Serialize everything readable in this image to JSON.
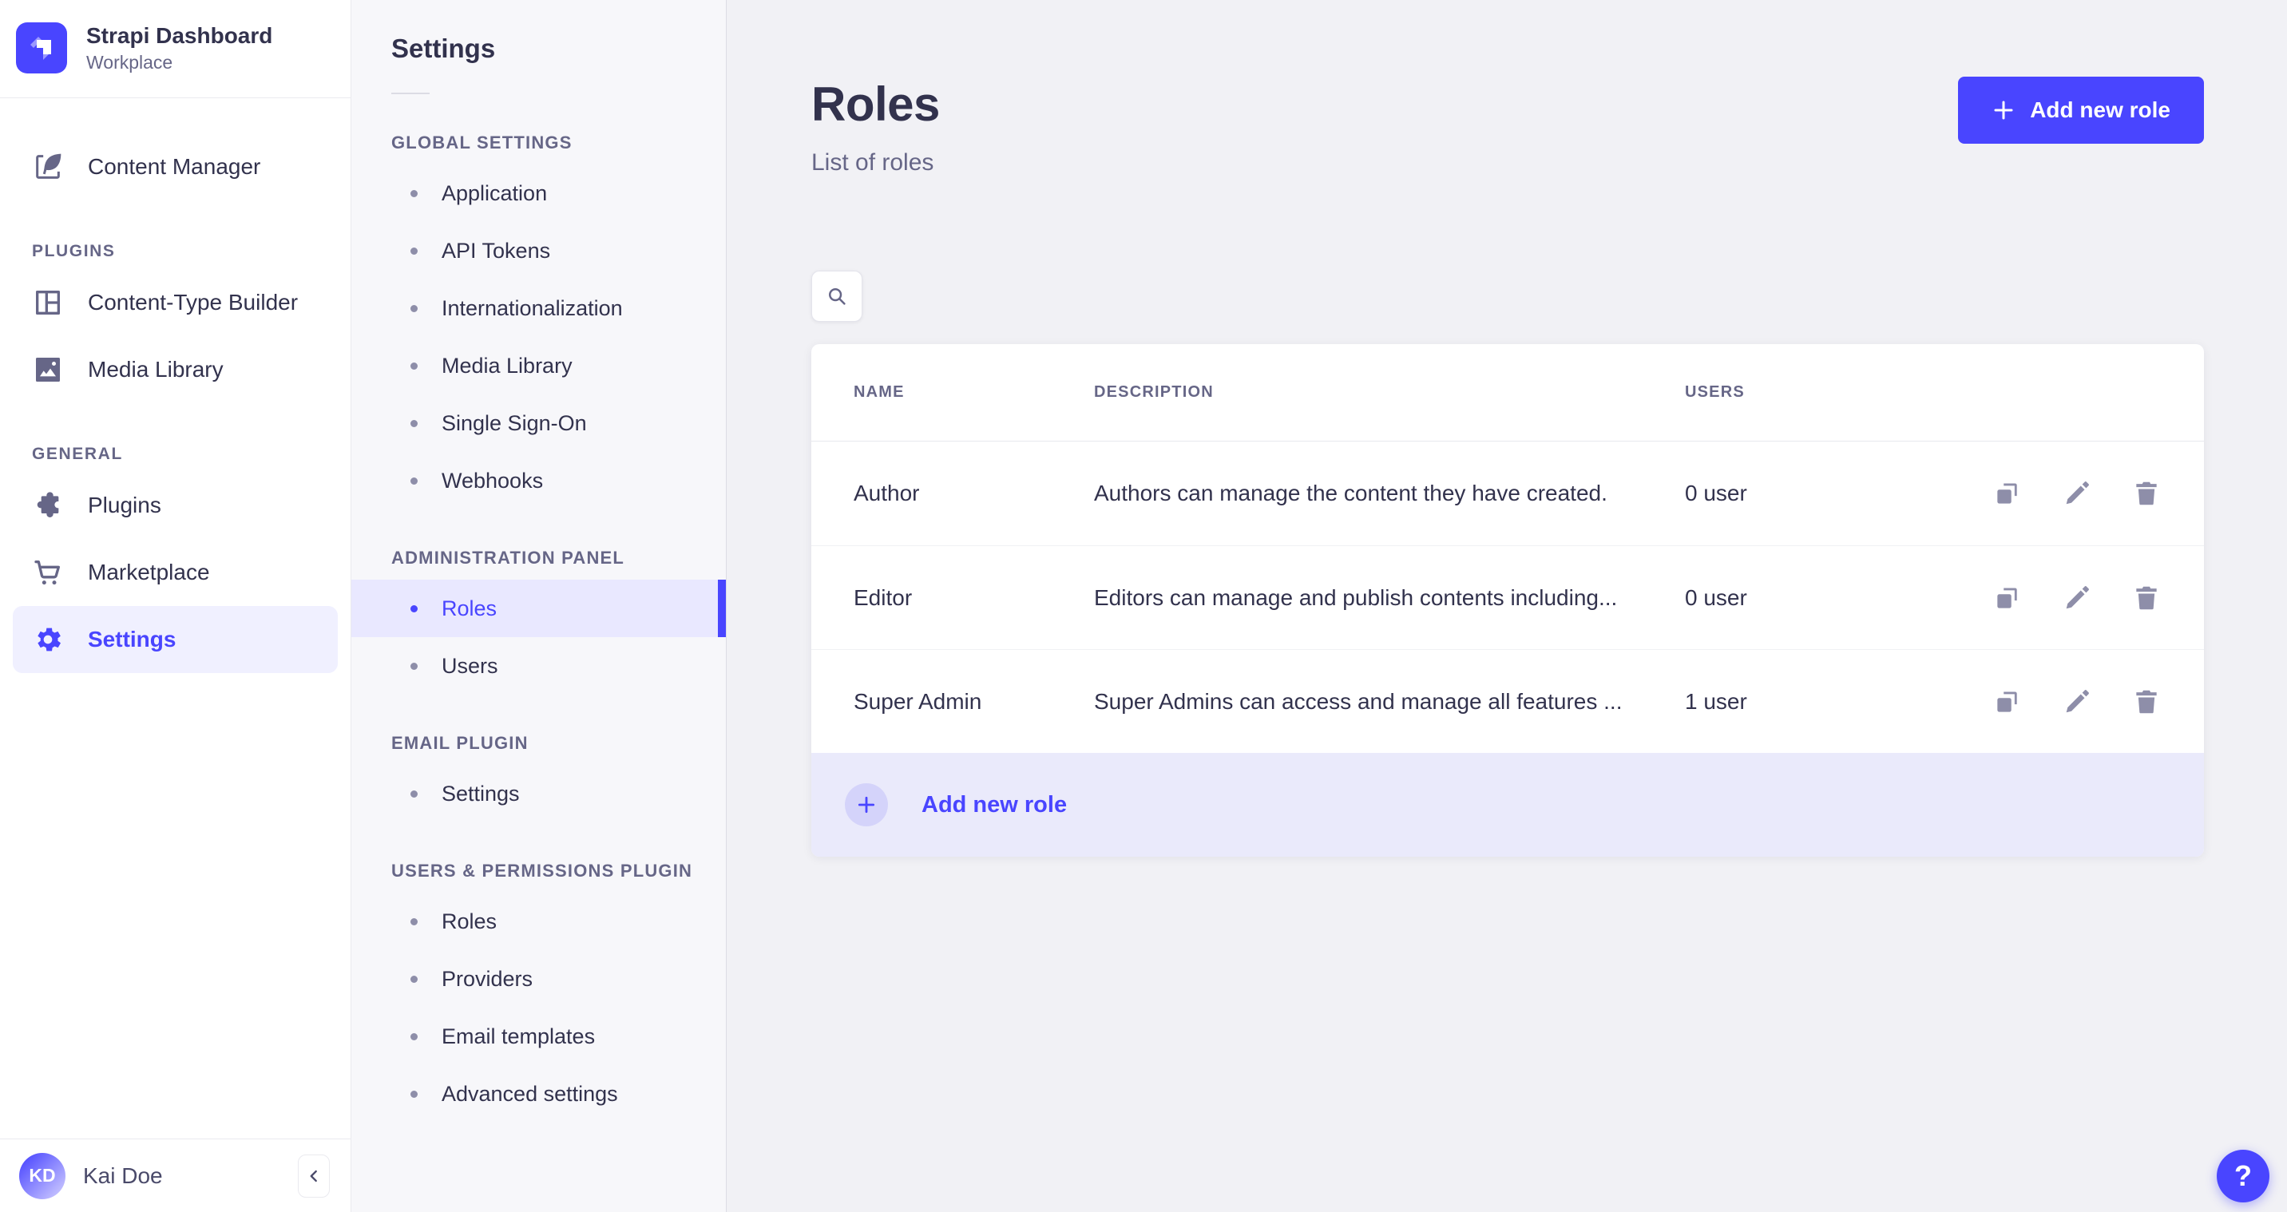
{
  "brand": {
    "title": "Strapi Dashboard",
    "subtitle": "Workplace"
  },
  "sidebar": {
    "content_manager": "Content Manager",
    "sections": [
      {
        "title": "PLUGINS",
        "items": [
          {
            "label": "Content-Type Builder"
          },
          {
            "label": "Media Library"
          }
        ]
      },
      {
        "title": "GENERAL",
        "items": [
          {
            "label": "Plugins"
          },
          {
            "label": "Marketplace"
          },
          {
            "label": "Settings"
          }
        ]
      }
    ],
    "user": {
      "initials": "KD",
      "name": "Kai Doe"
    }
  },
  "subnav": {
    "title": "Settings",
    "sections": [
      {
        "title": "GLOBAL SETTINGS",
        "items": [
          {
            "label": "Application"
          },
          {
            "label": "API Tokens"
          },
          {
            "label": "Internationalization"
          },
          {
            "label": "Media Library"
          },
          {
            "label": "Single Sign-On"
          },
          {
            "label": "Webhooks"
          }
        ]
      },
      {
        "title": "ADMINISTRATION PANEL",
        "items": [
          {
            "label": "Roles"
          },
          {
            "label": "Users"
          }
        ]
      },
      {
        "title": "EMAIL PLUGIN",
        "items": [
          {
            "label": "Settings"
          }
        ]
      },
      {
        "title": "USERS & PERMISSIONS PLUGIN",
        "items": [
          {
            "label": "Roles"
          },
          {
            "label": "Providers"
          },
          {
            "label": "Email templates"
          },
          {
            "label": "Advanced settings"
          }
        ]
      }
    ]
  },
  "main": {
    "title": "Roles",
    "subtitle": "List of roles",
    "add_button_label": "Add new role",
    "table": {
      "headers": [
        "NAME",
        "DESCRIPTION",
        "USERS"
      ],
      "rows": [
        {
          "name": "Author",
          "description": "Authors can manage the content they have created.",
          "users": "0 user"
        },
        {
          "name": "Editor",
          "description": "Editors can manage and publish contents including...",
          "users": "0 user"
        },
        {
          "name": "Super Admin",
          "description": "Super Admins can access and manage all features ...",
          "users": "1 user"
        }
      ],
      "footer_action_label": "Add new role"
    },
    "help_label": "?"
  },
  "colors": {
    "primary": "#4945ff",
    "active_bg": "#e9e8ff",
    "text": "#32324d",
    "muted": "#666687",
    "icon": "#8e8ea9"
  }
}
